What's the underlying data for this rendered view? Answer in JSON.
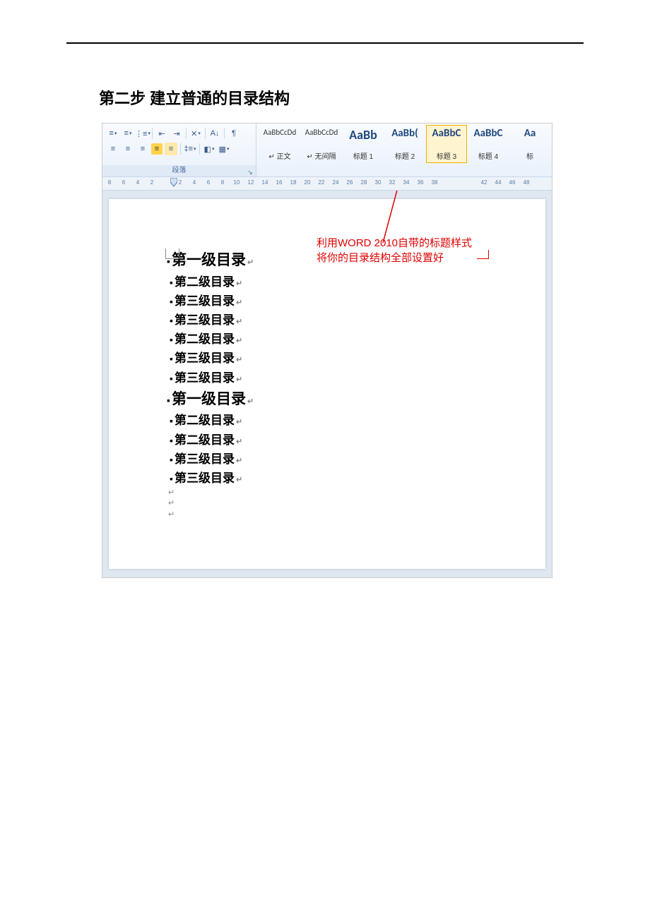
{
  "doc_heading": "第二步    建立普通的目录结构",
  "paragraph_group_label": "段落",
  "styles": [
    {
      "preview": "AaBbCcDd",
      "label": "↵ 正文",
      "cls": "small"
    },
    {
      "preview": "AaBbCcDd",
      "label": "↵ 无间隔",
      "cls": "small"
    },
    {
      "preview": "AaBb",
      "label": "标题 1",
      "cls": "big"
    },
    {
      "preview": "AaBb(",
      "label": "标题 2",
      "cls": "med"
    },
    {
      "preview": "AaBbC",
      "label": "标题 3",
      "cls": "med",
      "selected": true
    },
    {
      "preview": "AaBbC",
      "label": "标题 4",
      "cls": "med"
    },
    {
      "preview": "Aa",
      "label": "标",
      "cls": "med"
    }
  ],
  "ruler_numbers": [
    8,
    6,
    4,
    2,
    2,
    4,
    6,
    8,
    10,
    12,
    14,
    16,
    18,
    20,
    22,
    24,
    26,
    28,
    30,
    32,
    34,
    36,
    38,
    42,
    44,
    46,
    48
  ],
  "ruler_positions": [
    10,
    30,
    50,
    70,
    110,
    130,
    150,
    170,
    190,
    210,
    230,
    250,
    270,
    290,
    310,
    330,
    350,
    370,
    390,
    410,
    430,
    450,
    470,
    540,
    560,
    580,
    600
  ],
  "annotation_line1": "利用WORD 2010自带的标题样式",
  "annotation_line2": "将你的目录结构全部设置好",
  "outline": [
    {
      "text": "第一级目录",
      "level": 1
    },
    {
      "text": "第二级目录",
      "level": 2
    },
    {
      "text": "第三级目录",
      "level": 2
    },
    {
      "text": "第三级目录",
      "level": 2
    },
    {
      "text": "第二级目录",
      "level": 2
    },
    {
      "text": "第三级目录",
      "level": 2
    },
    {
      "text": "第三级目录",
      "level": 2
    },
    {
      "text": "第一级目录",
      "level": 1
    },
    {
      "text": "第二级目录",
      "level": 2
    },
    {
      "text": "第二级目录",
      "level": 2
    },
    {
      "text": "第三级目录",
      "level": 2
    },
    {
      "text": "第三级目录",
      "level": 2
    }
  ]
}
